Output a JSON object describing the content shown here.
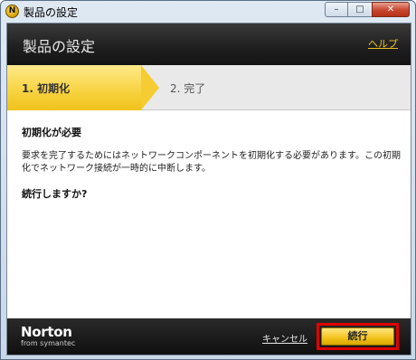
{
  "window": {
    "title": "製品の設定",
    "icon_glyph": "N",
    "controls": {
      "minimize": "–",
      "maximize": "□",
      "close": "✕"
    }
  },
  "header": {
    "title": "製品の設定",
    "help_label": "ヘルプ"
  },
  "steps": [
    {
      "label": "1. 初期化",
      "active": true
    },
    {
      "label": "2. 完了",
      "active": false
    }
  ],
  "content": {
    "heading": "初期化が必要",
    "body": "要求を完了するためにはネットワークコンポーネントを初期化する必要があります。この初期化でネットワーク接続が一時的に中断します。",
    "question": "続行しますか?"
  },
  "footer": {
    "logo_main": "Norton",
    "logo_sub": "from symantec",
    "cancel_label": "キャンセル",
    "continue_label": "続行"
  },
  "colors": {
    "accent_yellow": "#f5cd33",
    "header_dark": "#1e1e1e",
    "highlight_red": "#e00000"
  }
}
